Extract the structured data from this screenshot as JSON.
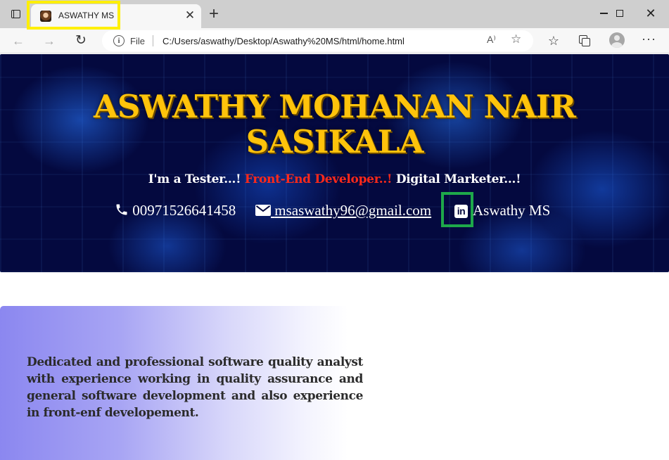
{
  "browser": {
    "tab": {
      "title": "ASWATHY MS",
      "close": "✕"
    },
    "new_tab": "+",
    "window": {
      "minimize": "",
      "maximize": "",
      "close": "✕"
    },
    "nav": {
      "back": "←",
      "forward": "→",
      "refresh": "↻"
    },
    "address": {
      "info": "i",
      "scheme_label": "File",
      "url": "C:/Users/aswathy/Desktop/Aswathy%20MS/html/home.html",
      "read_aloud": "A⁾",
      "favorite": "☆"
    },
    "toolbar": {
      "favorites": "☆",
      "more": "···"
    },
    "colors": {
      "tab_highlight": "#ffef00",
      "linkedin_highlight": "#1ea84a"
    }
  },
  "hero": {
    "name_line1": "ASWATHY MOHANAN NAIR",
    "name_line2": "SASIKALA",
    "tagline": {
      "part1": "I'm a Tester...! ",
      "part2": "Front-End Developer..!",
      "part3": " Digital Marketer...!"
    },
    "phone": "00971526641458",
    "email": "msaswathy96@gmail.com",
    "linkedin_icon_text": "in",
    "linkedin_name": "Aswathy MS",
    "colors": {
      "name": "#ffc30b",
      "accent": "#ff2a1a",
      "background": "#04093f"
    }
  },
  "about": {
    "text": "Dedicated and professional software quality analyst with experience working in quality assurance and general software development and also experience in front-enf developement."
  }
}
